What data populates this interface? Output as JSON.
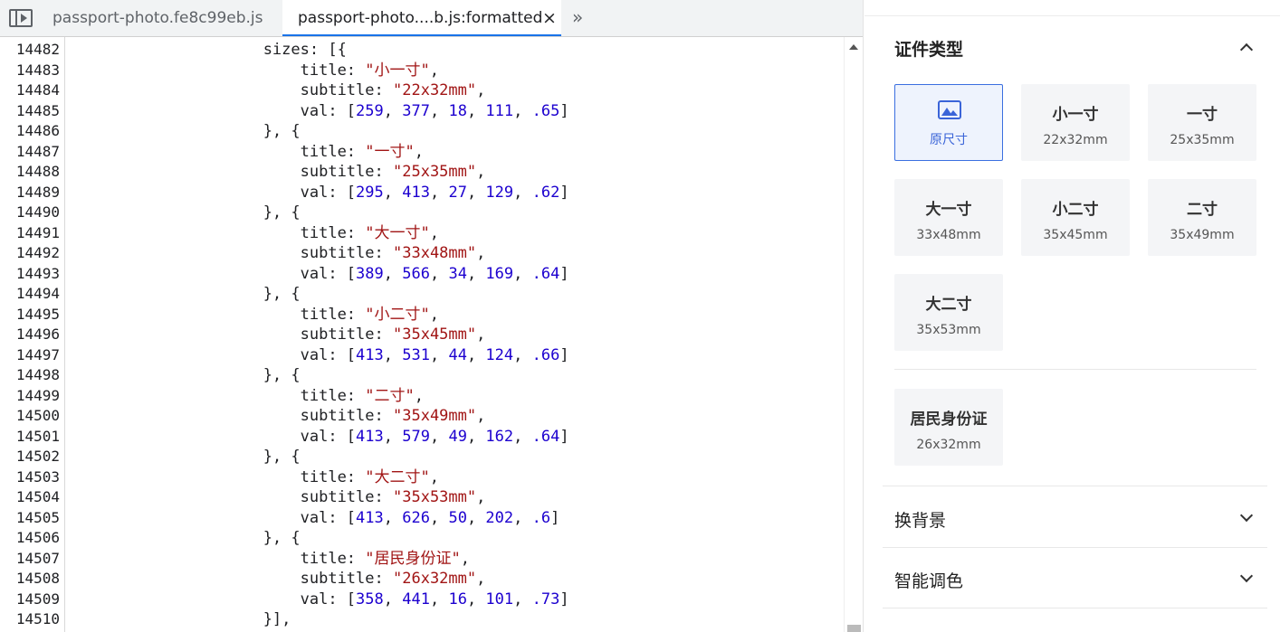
{
  "tabs": [
    {
      "label": "passport-photo.fe8c99eb.js"
    },
    {
      "label": "passport-photo....b.js:formatted",
      "close_symbol": "×"
    }
  ],
  "overflow_symbol": "»",
  "code": [
    {
      "n": "14482",
      "html": "                    sizes: [{"
    },
    {
      "n": "14483",
      "html": "                        title: <span class=\"str\">\"小一寸\"</span>,"
    },
    {
      "n": "14484",
      "html": "                        subtitle: <span class=\"str\">\"22x32mm\"</span>,"
    },
    {
      "n": "14485",
      "html": "                        val: [<span class=\"num\">259</span>, <span class=\"num\">377</span>, <span class=\"num\">18</span>, <span class=\"num\">111</span>, <span class=\"num\">.65</span>]"
    },
    {
      "n": "14486",
      "html": "                    }, {"
    },
    {
      "n": "14487",
      "html": "                        title: <span class=\"str\">\"一寸\"</span>,"
    },
    {
      "n": "14488",
      "html": "                        subtitle: <span class=\"str\">\"25x35mm\"</span>,"
    },
    {
      "n": "14489",
      "html": "                        val: [<span class=\"num\">295</span>, <span class=\"num\">413</span>, <span class=\"num\">27</span>, <span class=\"num\">129</span>, <span class=\"num\">.62</span>]"
    },
    {
      "n": "14490",
      "html": "                    }, {"
    },
    {
      "n": "14491",
      "html": "                        title: <span class=\"str\">\"大一寸\"</span>,"
    },
    {
      "n": "14492",
      "html": "                        subtitle: <span class=\"str\">\"33x48mm\"</span>,"
    },
    {
      "n": "14493",
      "html": "                        val: [<span class=\"num\">389</span>, <span class=\"num\">566</span>, <span class=\"num\">34</span>, <span class=\"num\">169</span>, <span class=\"num\">.64</span>]"
    },
    {
      "n": "14494",
      "html": "                    }, {"
    },
    {
      "n": "14495",
      "html": "                        title: <span class=\"str\">\"小二寸\"</span>,"
    },
    {
      "n": "14496",
      "html": "                        subtitle: <span class=\"str\">\"35x45mm\"</span>,"
    },
    {
      "n": "14497",
      "html": "                        val: [<span class=\"num\">413</span>, <span class=\"num\">531</span>, <span class=\"num\">44</span>, <span class=\"num\">124</span>, <span class=\"num\">.66</span>]"
    },
    {
      "n": "14498",
      "html": "                    }, {"
    },
    {
      "n": "14499",
      "html": "                        title: <span class=\"str\">\"二寸\"</span>,"
    },
    {
      "n": "14500",
      "html": "                        subtitle: <span class=\"str\">\"35x49mm\"</span>,"
    },
    {
      "n": "14501",
      "html": "                        val: [<span class=\"num\">413</span>, <span class=\"num\">579</span>, <span class=\"num\">49</span>, <span class=\"num\">162</span>, <span class=\"num\">.64</span>]"
    },
    {
      "n": "14502",
      "html": "                    }, {"
    },
    {
      "n": "14503",
      "html": "                        title: <span class=\"str\">\"大二寸\"</span>,"
    },
    {
      "n": "14504",
      "html": "                        subtitle: <span class=\"str\">\"35x53mm\"</span>,"
    },
    {
      "n": "14505",
      "html": "                        val: [<span class=\"num\">413</span>, <span class=\"num\">626</span>, <span class=\"num\">50</span>, <span class=\"num\">202</span>, <span class=\"num\">.6</span>]"
    },
    {
      "n": "14506",
      "html": "                    }, {"
    },
    {
      "n": "14507",
      "html": "                        title: <span class=\"str\">\"居民身份证\"</span>,"
    },
    {
      "n": "14508",
      "html": "                        subtitle: <span class=\"str\">\"26x32mm\"</span>,"
    },
    {
      "n": "14509",
      "html": "                        val: [<span class=\"num\">358</span>, <span class=\"num\">441</span>, <span class=\"num\">16</span>, <span class=\"num\">101</span>, <span class=\"num\">.73</span>]"
    },
    {
      "n": "14510",
      "html": "                    }],"
    }
  ],
  "panel": {
    "doc_type_title": "证件类型",
    "original_card": {
      "label": "原尺寸",
      "icon": "image-icon"
    },
    "cards": [
      {
        "title": "小一寸",
        "subtitle": "22x32mm"
      },
      {
        "title": "一寸",
        "subtitle": "25x35mm"
      },
      {
        "title": "大一寸",
        "subtitle": "33x48mm"
      },
      {
        "title": "小二寸",
        "subtitle": "35x45mm"
      },
      {
        "title": "二寸",
        "subtitle": "35x49mm"
      },
      {
        "title": "大二寸",
        "subtitle": "35x53mm"
      },
      {
        "title": "居民身份证",
        "subtitle": "26x32mm"
      }
    ],
    "bg_title": "换背景",
    "color_title": "智能调色"
  },
  "colors": {
    "accent": "#3a64d8",
    "string": "#a11515",
    "number": "#1c00cf",
    "active_tab_underline": "#1a73e8"
  }
}
